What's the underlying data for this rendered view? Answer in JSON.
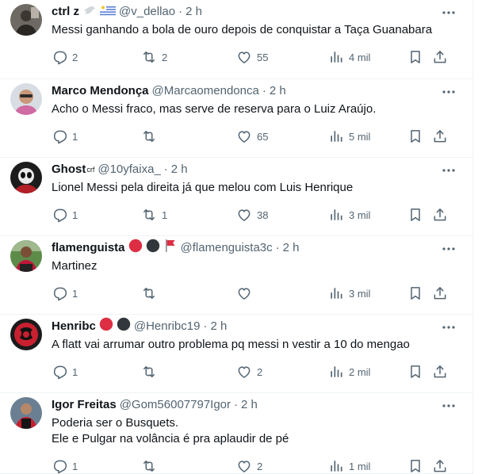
{
  "tweets": [
    {
      "name": "ctrl z",
      "handle": "@v_dellao",
      "time": "2 h",
      "text": "Messi ganhando a bola de ouro depois de conquistar a Taça Guanabara",
      "replies": "2",
      "retweets": "2",
      "likes": "55",
      "views": "4 mil",
      "name_emojis": [
        "dove-emoji",
        "uruguay-flag-emoji"
      ]
    },
    {
      "name": "Marco Mendonça",
      "handle": "@Marcaomendonca",
      "time": "2 h",
      "text": "Acho o Messi fraco, mas serve de reserva para o Luiz Araújo.",
      "replies": "1",
      "retweets": "",
      "likes": "65",
      "views": "5 mil",
      "name_emojis": []
    },
    {
      "name": "Ghost",
      "name_suffix": "crf",
      "handle": "@10yfaixa_",
      "time": "2 h",
      "text": "Lionel Messi pela direita já que melou com Luis Henrique",
      "replies": "1",
      "retweets": "1",
      "likes": "38",
      "views": "3 mil",
      "name_emojis": []
    },
    {
      "name": "flamenguista",
      "handle": "@flamenguista3c",
      "time": "2 h",
      "text": "Martinez",
      "replies": "1",
      "retweets": "",
      "likes": "",
      "views": "3 mil",
      "name_emojis": [
        "red-circle-emoji",
        "black-circle-emoji",
        "red-flag-emoji"
      ]
    },
    {
      "name": "Henribc",
      "handle": "@Henribc19",
      "time": "2 h",
      "text": "A flatt vai arrumar outro problema pq messi n vestir a 10 do mengao",
      "replies": "1",
      "retweets": "",
      "likes": "2",
      "views": "2 mil",
      "name_emojis": [
        "red-circle-emoji",
        "black-circle-emoji"
      ]
    },
    {
      "name": "Igor Freitas",
      "handle": "@Gom56007797Igor",
      "time": "2 h",
      "text": "Poderia ser o Busquets.\nEle e Pulgar na volância é pra aplaudir de pé",
      "replies": "1",
      "retweets": "",
      "likes": "2",
      "views": "1 mil",
      "name_emojis": []
    }
  ],
  "separator": "·",
  "colors": {
    "text": "#0f1419",
    "secondary": "#536471",
    "border": "#eff3f4"
  }
}
